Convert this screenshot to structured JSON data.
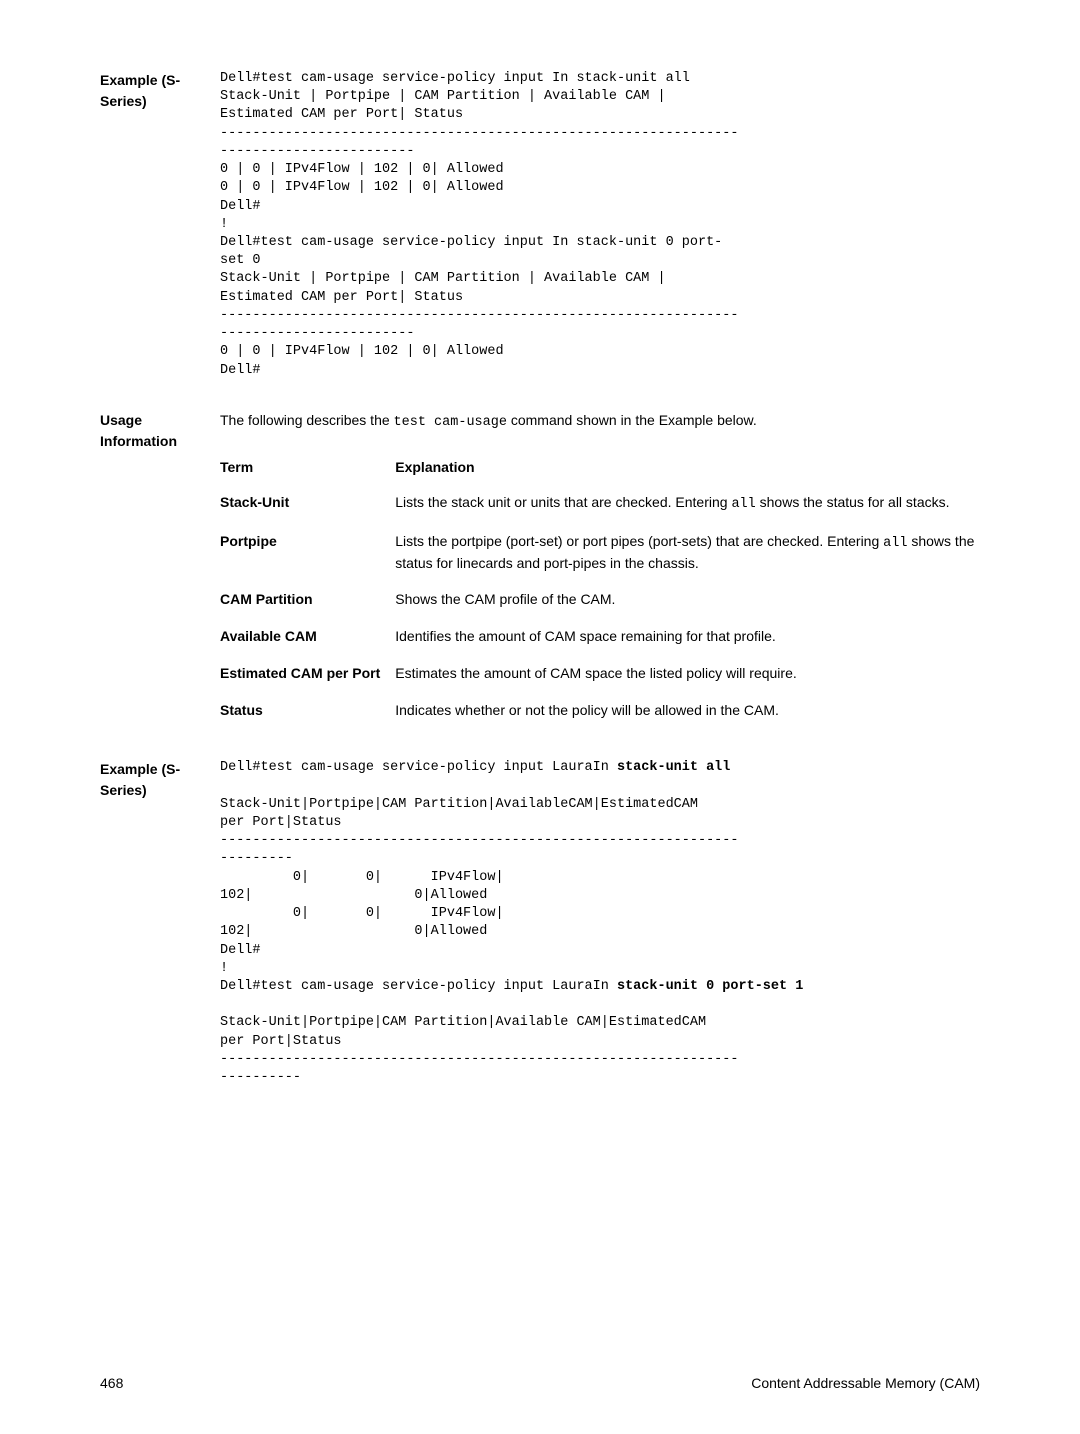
{
  "example1": {
    "label": "Example (S-Series)",
    "code": "Dell#test cam-usage service-policy input In stack-unit all\nStack-Unit | Portpipe | CAM Partition | Available CAM | \nEstimated CAM per Port| Status\n----------------------------------------------------------------\n------------------------\n0 | 0 | IPv4Flow | 102 | 0| Allowed\n0 | 0 | IPv4Flow | 102 | 0| Allowed\nDell#\n!\nDell#test cam-usage service-policy input In stack-unit 0 port-\nset 0\nStack-Unit | Portpipe | CAM Partition | Available CAM | \nEstimated CAM per Port| Status\n----------------------------------------------------------------\n------------------------\n0 | 0 | IPv4Flow | 102 | 0| Allowed\nDell#"
  },
  "usage": {
    "label": "Usage Information",
    "intro_prefix": "The following describes the ",
    "intro_code": "test cam-usage",
    "intro_suffix": " command shown in the Example below.",
    "term_header": "Term",
    "exp_header": "Explanation",
    "rows": {
      "r0": {
        "term": "Stack-Unit",
        "exp_prefix": "Lists the stack unit or units that are checked. Entering ",
        "exp_code": "all",
        "exp_suffix": " shows the status for all stacks."
      },
      "r1": {
        "term": "Portpipe",
        "exp_prefix": "Lists the portpipe (port-set) or port pipes (port-sets) that are checked. Entering ",
        "exp_code": "all",
        "exp_suffix": " shows the status for linecards and port-pipes in the chassis."
      },
      "r2": {
        "term": "CAM Partition",
        "exp": "Shows the CAM profile of the CAM."
      },
      "r3": {
        "term": "Available CAM",
        "exp": "Identifies the amount of CAM space remaining for that profile."
      },
      "r4": {
        "term": "Estimated CAM per Port",
        "exp": "Estimates the amount of CAM space the listed policy will require."
      },
      "r5": {
        "term": "Status",
        "exp": "Indicates whether or not the policy will be allowed in the CAM."
      }
    }
  },
  "example2": {
    "label": "Example (S-Series)",
    "line1_prefix": "Dell#test cam-usage service-policy input LauraIn ",
    "line1_bold": "stack-unit all",
    "block1": "\nStack-Unit|Portpipe|CAM Partition|AvailableCAM|EstimatedCAM \nper Port|Status\n----------------------------------------------------------------\n---------\n         0|       0|      IPv4Flow|          \n102|                    0|Allowed\n         0|       0|      IPv4Flow|          \n102|                    0|Allowed\nDell#\n!\nDell#test cam-usage service-policy input LauraIn ",
    "line2_bold": "stack-unit 0 port-set 1",
    "block2": "\nStack-Unit|Portpipe|CAM Partition|Available CAM|EstimatedCAM \nper Port|Status\n----------------------------------------------------------------\n----------"
  },
  "footer": {
    "page": "468",
    "title": "Content Addressable Memory (CAM)"
  }
}
